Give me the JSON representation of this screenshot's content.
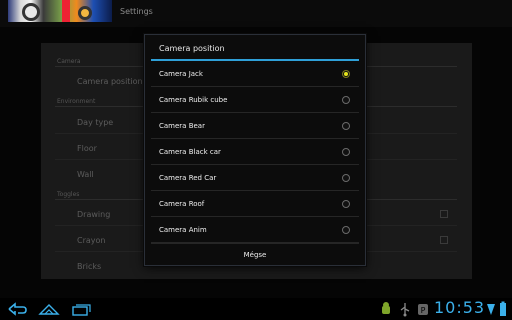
{
  "actionbar": {
    "title": "Settings"
  },
  "settings": {
    "sections": [
      {
        "title": "Camera",
        "items": [
          "Camera position"
        ]
      },
      {
        "title": "Environment",
        "items": [
          "Day type",
          "Floor",
          "Wall"
        ]
      },
      {
        "title": "Toggles",
        "items": [
          "Drawing",
          "Crayon",
          "Bricks"
        ]
      }
    ]
  },
  "dialog": {
    "title": "Camera position",
    "selected_index": 0,
    "options": [
      {
        "label": "Camera Jack"
      },
      {
        "label": "Camera Rubik cube"
      },
      {
        "label": "Camera Bear"
      },
      {
        "label": "Camera Black car"
      },
      {
        "label": "Camera Red Car"
      },
      {
        "label": "Camera Roof"
      },
      {
        "label": "Camera Anim"
      }
    ],
    "cancel_label": "Mégse"
  },
  "system_bar": {
    "clock": "10:53",
    "accent_color": "#3bb0ea",
    "icons": [
      "back-icon",
      "home-icon",
      "recent-apps-icon",
      "android-debug-icon",
      "usb-icon",
      "parking-icon",
      "wifi-icon",
      "battery-icon"
    ]
  }
}
